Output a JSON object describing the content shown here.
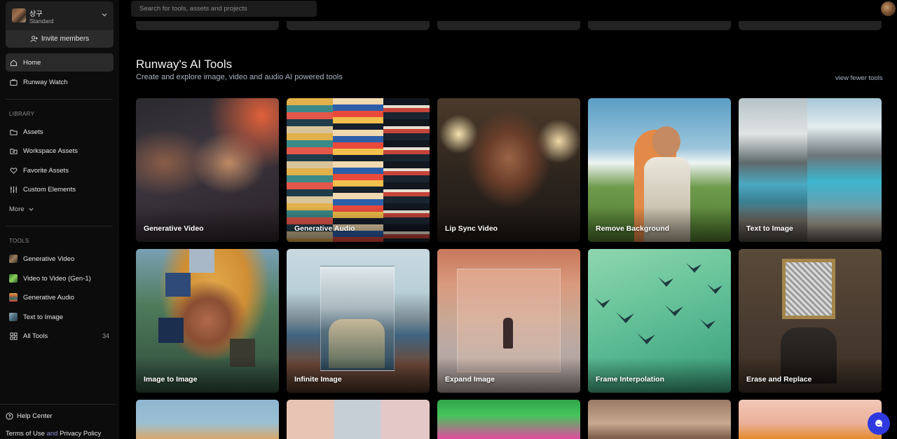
{
  "workspace": {
    "name": "상구",
    "plan": "Standard",
    "invite_label": "Invite members"
  },
  "nav": [
    {
      "label": "Home",
      "icon": "home-icon",
      "active": true
    },
    {
      "label": "Runway Watch",
      "icon": "tv-icon",
      "active": false
    }
  ],
  "library": {
    "heading": "LIBRARY",
    "items": [
      {
        "label": "Assets",
        "icon": "folder-icon"
      },
      {
        "label": "Workspace Assets",
        "icon": "shared-folder-icon"
      },
      {
        "label": "Favorite Assets",
        "icon": "heart-icon"
      },
      {
        "label": "Custom Elements",
        "icon": "sliders-icon"
      }
    ],
    "more_label": "More"
  },
  "tools": {
    "heading": "TOOLS",
    "items": [
      {
        "label": "Generative Video",
        "thumb_color": "#6b5a4a"
      },
      {
        "label": "Video to Video (Gen-1)",
        "thumb_color": "#3f9d3a"
      },
      {
        "label": "Generative Audio",
        "thumb_color": "#c9623a"
      },
      {
        "label": "Text to Image",
        "thumb_color": "#5c7f95"
      }
    ],
    "all_tools_label": "All Tools",
    "all_tools_count": "34"
  },
  "footer": {
    "help": "Help Center",
    "terms": "Terms of Use",
    "and": "and",
    "privacy": "Privacy Policy"
  },
  "search": {
    "placeholder": "Search for tools, assets and projects"
  },
  "section": {
    "title": "Runway's AI Tools",
    "subtitle": "Create and explore image, video and audio AI powered tools",
    "toggle_label": "view fewer tools"
  },
  "cards": [
    {
      "label": "Generative Video"
    },
    {
      "label": "Generative Audio"
    },
    {
      "label": "Lip Sync Video"
    },
    {
      "label": "Remove Background"
    },
    {
      "label": "Text to Image"
    },
    {
      "label": "Image to Image"
    },
    {
      "label": "Infinite Image"
    },
    {
      "label": "Expand Image"
    },
    {
      "label": "Frame Interpolation"
    },
    {
      "label": "Erase and Replace"
    }
  ],
  "colors": {
    "accent": "#2f39e0",
    "active_nav": "#2a2a2a",
    "sidebar": "#0c0c0c"
  }
}
